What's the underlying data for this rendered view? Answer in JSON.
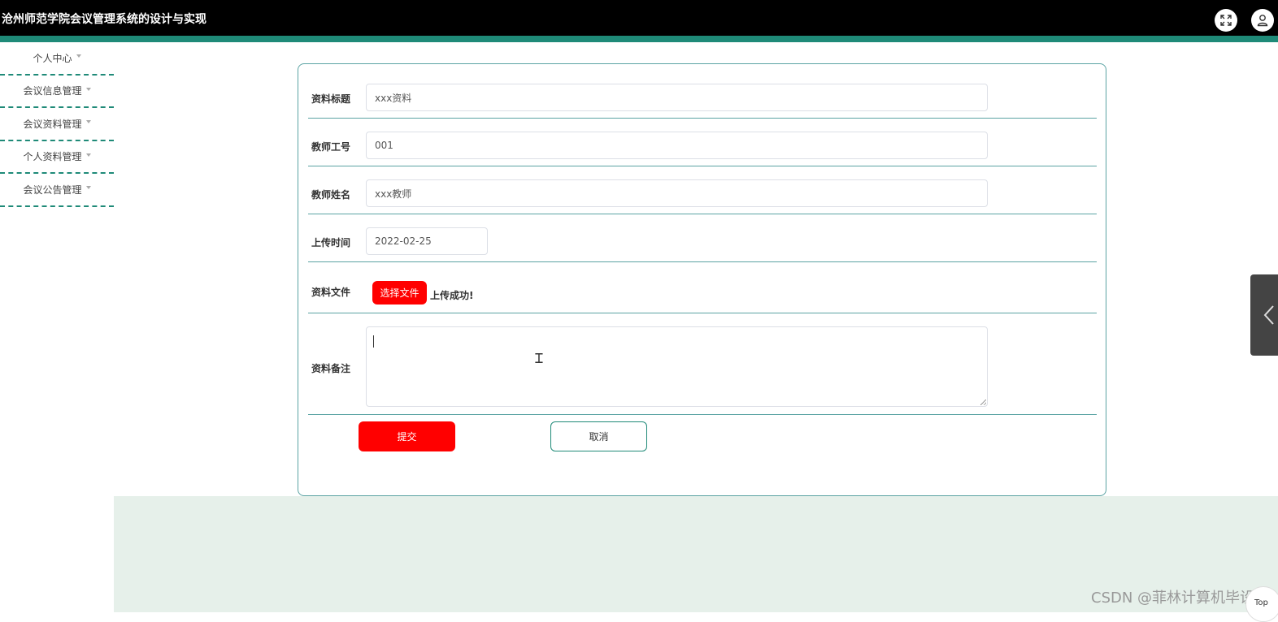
{
  "header": {
    "title": "沧州师范学院会议管理系统的设计与实现",
    "fullscreen_icon": "fullscreen-icon",
    "user_icon": "user-icon"
  },
  "sidebar": {
    "items": [
      {
        "label": "个人中心"
      },
      {
        "label": "会议信息管理"
      },
      {
        "label": "会议资料管理"
      },
      {
        "label": "个人资料管理"
      },
      {
        "label": "会议公告管理"
      }
    ]
  },
  "form": {
    "title_label": "资料标题",
    "title_value": "xxx资料",
    "teacher_id_label": "教师工号",
    "teacher_id_value": "001",
    "teacher_name_label": "教师姓名",
    "teacher_name_value": "xxx教师",
    "upload_time_label": "上传时间",
    "upload_time_value": "2022-02-25",
    "file_label": "资料文件",
    "file_button": "选择文件",
    "file_status": "上传成功!",
    "remark_label": "资料备注",
    "remark_value": "",
    "submit_label": "提交",
    "cancel_label": "取消"
  },
  "footer": {
    "watermark": "CSDN @菲林计算机毕设",
    "top_label": "Top"
  },
  "colors": {
    "accent": "#1f8a78",
    "border": "#5ba3a3",
    "primary_button": "#ff0000",
    "topbar": "#000000"
  }
}
